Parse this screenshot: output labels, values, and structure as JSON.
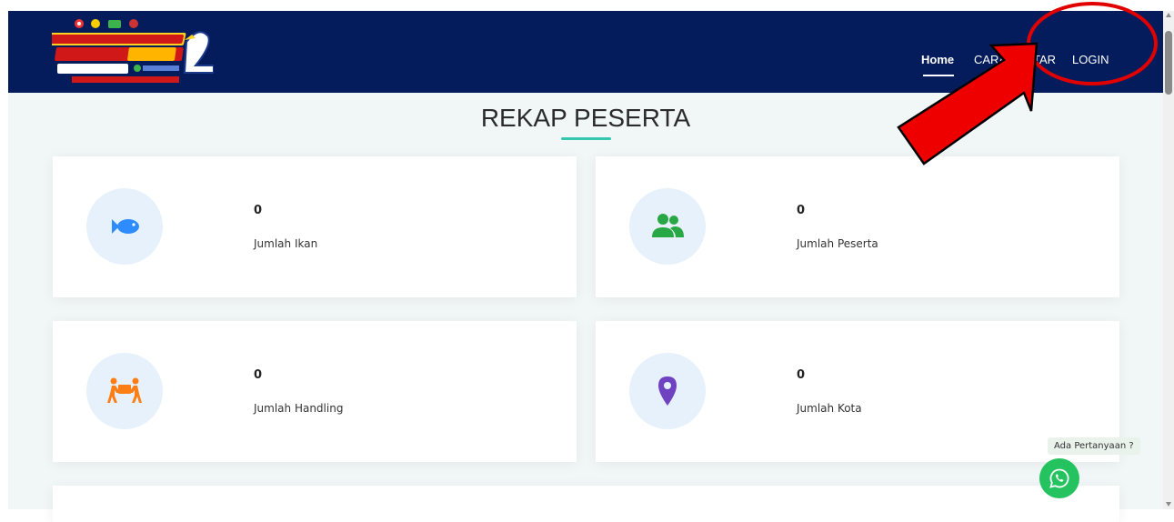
{
  "navbar": {
    "logo": {
      "alt_lines": [
        "WALI KOTA BLITAR CUP",
        "KOI FESTIVAL 2025",
        "05 - 06 DESEMBER 2025",
        "2"
      ]
    },
    "links": [
      {
        "label": "Home",
        "active": true
      },
      {
        "label": "CARA DAFTAR",
        "active": false
      },
      {
        "label": "LOGIN",
        "active": false
      }
    ],
    "background": "#041c5c"
  },
  "section": {
    "title": "REKAP PESERTA",
    "accent": "#33c7b0"
  },
  "stats": [
    {
      "value": "0",
      "label": "Jumlah Ikan",
      "icon": "fish-icon",
      "color": "#2f8cff"
    },
    {
      "value": "0",
      "label": "Jumlah Peserta",
      "icon": "users-icon",
      "color": "#28a745"
    },
    {
      "value": "0",
      "label": "Jumlah Handling",
      "icon": "people-carry-icon",
      "color": "#fd7e14"
    },
    {
      "value": "0",
      "label": "Jumlah Kota",
      "icon": "map-marker-icon",
      "color": "#6f42c1"
    }
  ],
  "whatsapp": {
    "tooltip": "Ada Pertanyaan ?",
    "icon": "whatsapp-icon",
    "color": "#25c35f"
  },
  "annotation": {
    "color": "#e00000",
    "shapes": [
      "red-circle",
      "red-arrow"
    ]
  }
}
